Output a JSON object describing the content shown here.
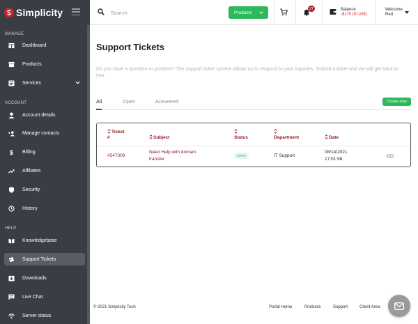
{
  "brand": {
    "name": "Simplicity",
    "icon": "logo-icon"
  },
  "sidebar": {
    "sections": [
      {
        "label": "Manage"
      },
      {
        "label": "Account"
      },
      {
        "label": "Help"
      }
    ],
    "items": [
      {
        "label": "Dashboard",
        "icon": "dashboard-icon"
      },
      {
        "label": "Products",
        "icon": "box-icon"
      },
      {
        "label": "Services",
        "icon": "services-icon"
      },
      {
        "label": "Account details",
        "icon": "user-icon"
      },
      {
        "label": "Manage contacts",
        "icon": "contacts-icon"
      },
      {
        "label": "Billing",
        "icon": "dollar-icon"
      },
      {
        "label": "Affiliates",
        "icon": "trend-icon"
      },
      {
        "label": "Security",
        "icon": "shield-icon"
      },
      {
        "label": "History",
        "icon": "history-icon"
      },
      {
        "label": "Knowledgebase",
        "icon": "book-icon"
      },
      {
        "label": "Support Tickets",
        "icon": "ticket-icon"
      },
      {
        "label": "Downloads",
        "icon": "download-icon"
      },
      {
        "label": "Live Chat",
        "icon": "chat-icon"
      },
      {
        "label": "Server status",
        "icon": "wifi-icon"
      }
    ]
  },
  "header": {
    "search_placeholder": "Search",
    "products_label": "Products",
    "notifications_count": "27",
    "balance_label": "Balance",
    "balance_value": "-$170.00 USD",
    "welcome_label": "Welcome",
    "user_name": "Red"
  },
  "main": {
    "title": "Support Tickets",
    "description": "Do you have a question or problem? The support ticket system allows us to respond to your inquiries. Submit a ticket and we will get back to you.",
    "tabs": [
      {
        "label": "All",
        "active": true
      },
      {
        "label": "Open",
        "active": false
      },
      {
        "label": "Answered",
        "active": false
      }
    ],
    "create_label": "Create new",
    "table": {
      "headers": {
        "ticket_line1": "Ticket",
        "ticket_line2": "#",
        "subject": "Subject",
        "status": "Status",
        "department": "Department",
        "date": "Date"
      },
      "rows": [
        {
          "ticket": "#547309",
          "subject_line1": "Need Help with domain",
          "subject_line2": "transfer",
          "status": "OPEN",
          "department": "IT Support",
          "date_line1": "08/14/2021",
          "date_line2": "17:01:58"
        }
      ]
    }
  },
  "footer": {
    "copyright": "© 2021 Simplicity Tech",
    "links": [
      "Portal Home",
      "Products",
      "Support",
      "Client Area"
    ]
  },
  "colors": {
    "sidebar": "#3a3d44",
    "accent": "#2eb85c",
    "brand": "#c4262e",
    "link": "#8b1e25"
  }
}
